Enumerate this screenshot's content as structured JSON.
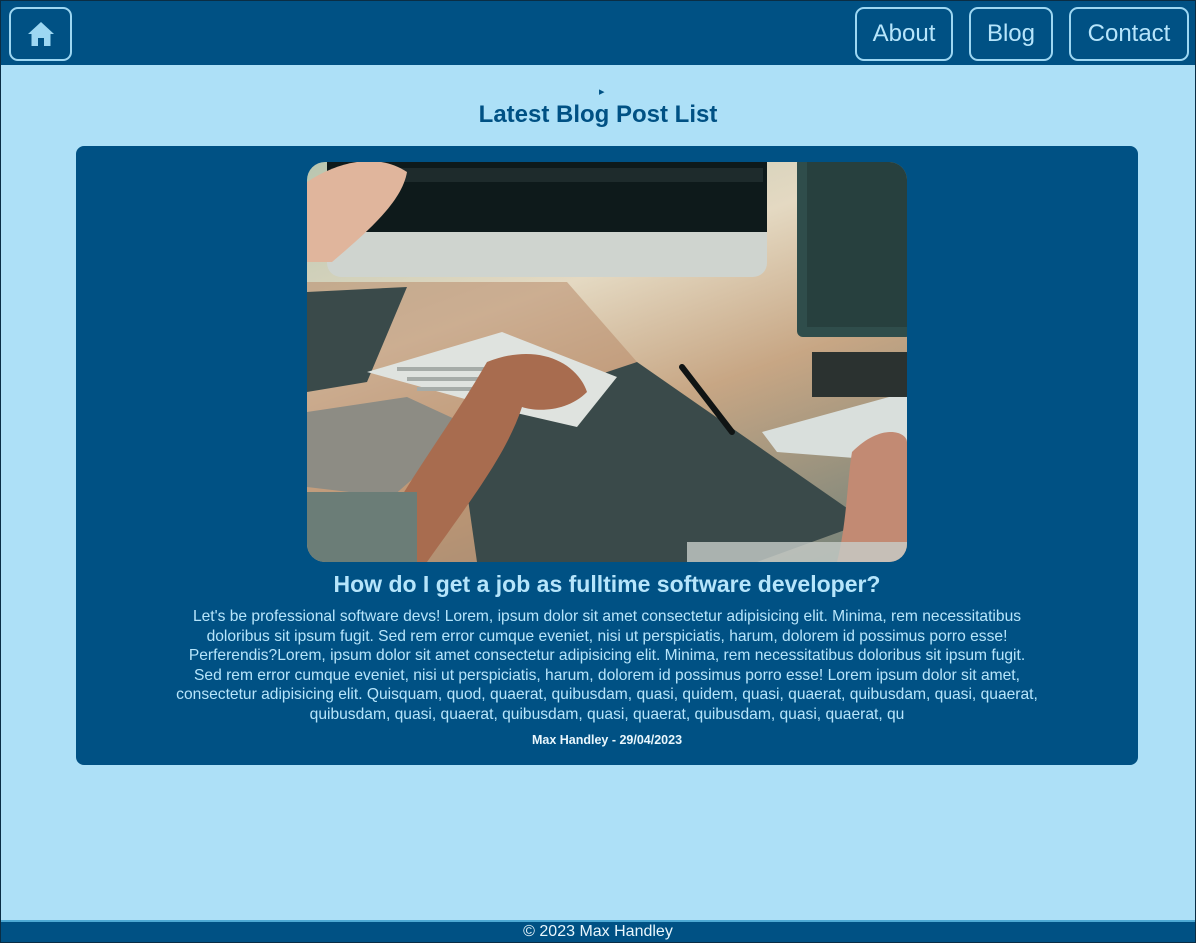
{
  "nav": {
    "home_icon": "home-icon",
    "about_label": "About",
    "blog_label": "Blog",
    "contact_label": "Contact"
  },
  "main": {
    "toggle_glyph": "▸",
    "title": "Latest Blog Post List"
  },
  "post": {
    "title": "How do I get a job as fulltime software developer?",
    "body": "Let's be professional software devs! Lorem, ipsum dolor sit amet consectetur adipisicing elit. Minima, rem necessitatibus doloribus sit ipsum fugit. Sed rem error cumque eveniet, nisi ut perspiciatis, harum, dolorem id possimus porro esse! Perferendis?Lorem, ipsum dolor sit amet consectetur adipisicing elit. Minima, rem necessitatibus doloribus sit ipsum fugit. Sed rem error cumque eveniet, nisi ut perspiciatis, harum, dolorem id possimus porro esse! Lorem ipsum dolor sit amet, consectetur adipisicing elit. Quisquam, quod, quaerat, quibusdam, quasi, quidem, quasi, quaerat, quibusdam, quasi, quaerat, quibusdam, quasi, quaerat, quibusdam, quasi, quaerat, quibusdam, quasi, quaerat, qu",
    "meta": "Max Handley - 29/04/2023"
  },
  "footer": {
    "text": "© 2023 Max Handley"
  },
  "colors": {
    "navy": "#005184",
    "light_blue": "#ade0f7",
    "text_light": "#b6e5fb"
  }
}
